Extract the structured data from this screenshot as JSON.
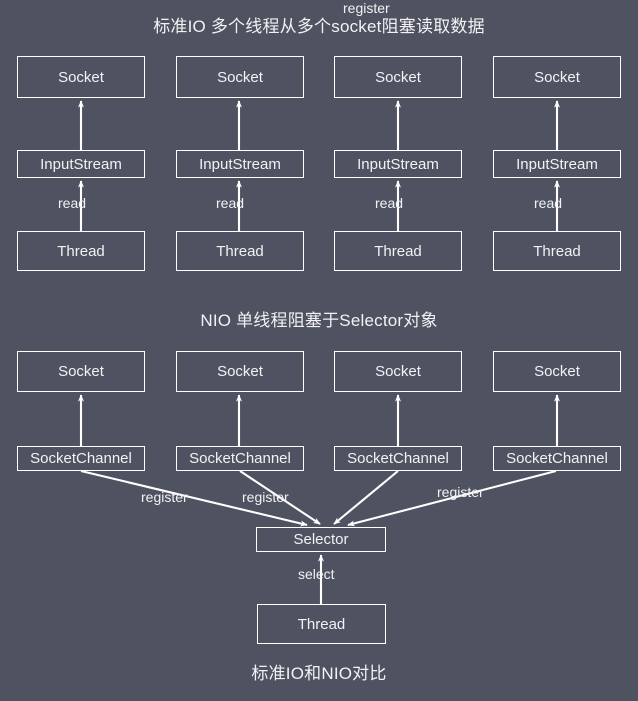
{
  "figure": {
    "background_color": "#4f5260",
    "stroke_color": "#ffffff",
    "text_color": "#f2f2f4",
    "caption": "标准IO和NIO对比"
  },
  "sections": {
    "standard_io": {
      "title": "标准IO 多个线程从多个socket阻塞读取数据",
      "columns": [
        {
          "socket": "Socket",
          "stream": "InputStream",
          "edge": "read",
          "thread": "Thread"
        },
        {
          "socket": "Socket",
          "stream": "InputStream",
          "edge": "read",
          "thread": "Thread"
        },
        {
          "socket": "Socket",
          "stream": "InputStream",
          "edge": "read",
          "thread": "Thread"
        },
        {
          "socket": "Socket",
          "stream": "InputStream",
          "edge": "read",
          "thread": "Thread"
        }
      ]
    },
    "nio": {
      "title": "NIO 单线程阻塞于Selector对象",
      "columns": [
        {
          "socket": "Socket",
          "channel": "SocketChannel",
          "edge": "register"
        },
        {
          "socket": "Socket",
          "channel": "SocketChannel",
          "edge": "register"
        },
        {
          "socket": "Socket",
          "channel": "SocketChannel",
          "edge": "register"
        },
        {
          "socket": "Socket",
          "channel": "SocketChannel",
          "edge": "register"
        }
      ],
      "selector": "Selector",
      "select_edge": "select",
      "thread": "Thread"
    }
  }
}
